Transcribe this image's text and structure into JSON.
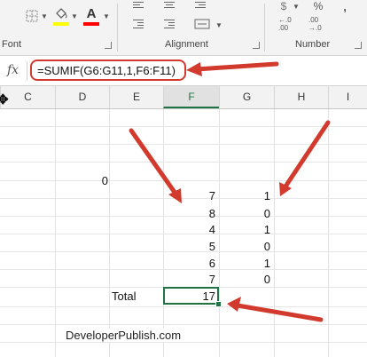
{
  "ribbon": {
    "font_group_label": "Font",
    "alignment_group_label": "Alignment",
    "number_group_label": "Number",
    "font_color_letter": "A",
    "currency_symbol": "$",
    "percent_symbol": "%",
    "comma_symbol": ",",
    "dec_increase_top": "←.0",
    "dec_increase_bottom": ".00",
    "dec_decrease_top": ".00",
    "dec_decrease_bottom": "→.0",
    "fill_color": "#ffff00",
    "font_color": "#ff0000"
  },
  "formula_bar": {
    "fx_label": "fx",
    "formula": "=SUMIF(G6:G11,1,F6:F11)"
  },
  "columns": [
    "C",
    "D",
    "E",
    "F",
    "G",
    "H",
    "I"
  ],
  "active_column": "F",
  "cells": {
    "d_value": "0",
    "f_values": [
      "7",
      "8",
      "4",
      "5",
      "6",
      "7"
    ],
    "g_values": [
      "1",
      "0",
      "1",
      "0",
      "1",
      "0"
    ],
    "total_label": "Total",
    "total_value": "17"
  },
  "watermark": "DeveloperPublish.com",
  "colors": {
    "arrow": "#d33a2e",
    "selection": "#217346"
  }
}
